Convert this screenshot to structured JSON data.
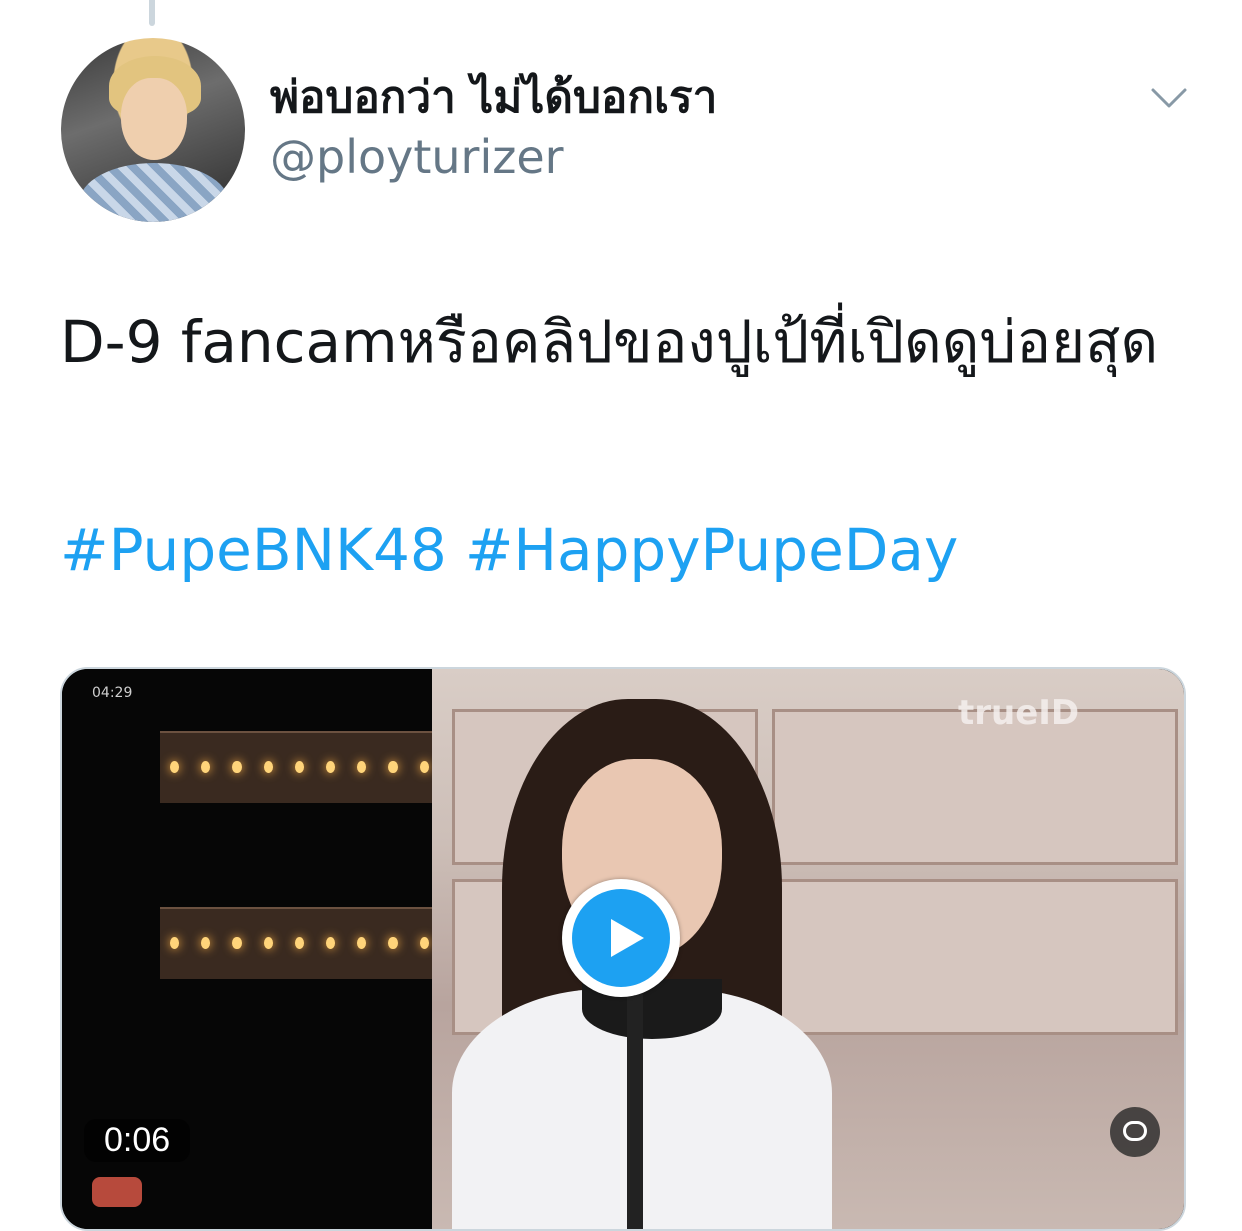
{
  "tweet": {
    "display_name": "พ่อบอกว่า ไม่ได้บอกเรา",
    "handle": "@ployturizer",
    "text": "D-9 fancamหรือคลิปของปูเป้ที่เปิดดูบ่อยสุด",
    "hashtags": [
      "#PupeBNK48",
      "#HappyPupeDay"
    ],
    "accent_color": "#1da1f2"
  },
  "media": {
    "type": "video",
    "duration": "0:06",
    "watermark": "trueID",
    "osd_time": "04:29",
    "play_icon": "play-icon",
    "caption_icon": "captions-icon"
  },
  "icons": {
    "menu": "chevron-down-icon"
  }
}
